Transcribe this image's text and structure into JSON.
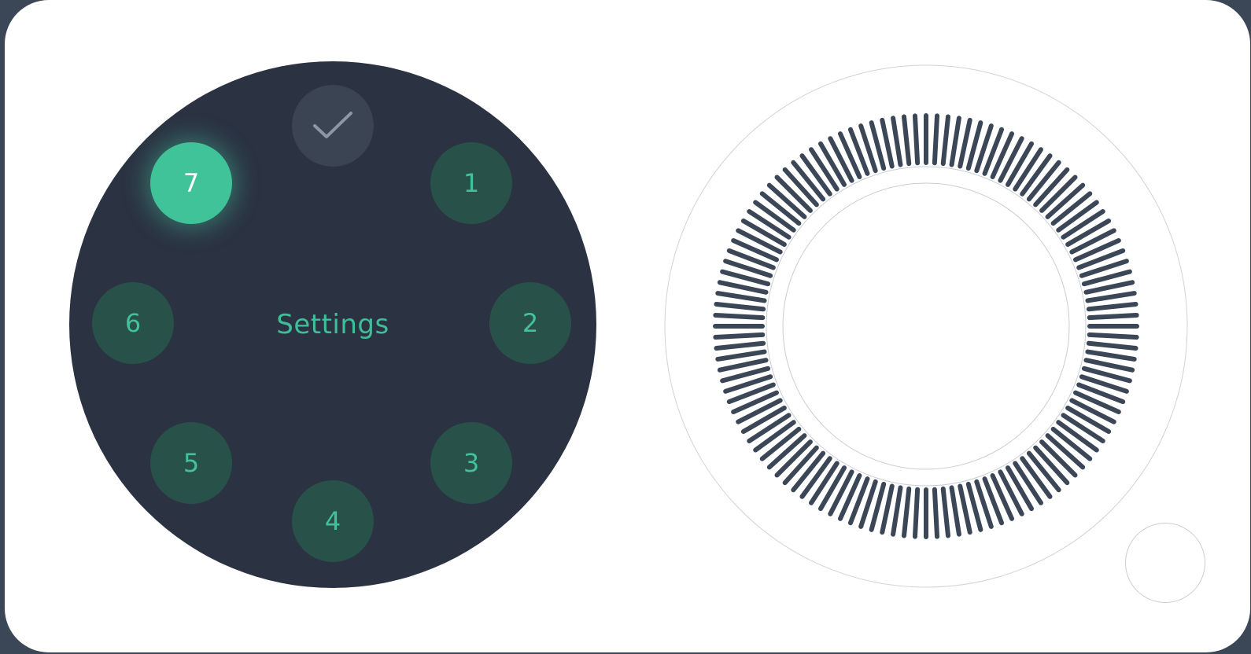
{
  "menu": {
    "title": "Settings",
    "confirm_icon": "check-icon",
    "options": [
      {
        "label": "1",
        "selected": false
      },
      {
        "label": "2",
        "selected": false
      },
      {
        "label": "3",
        "selected": false
      },
      {
        "label": "4",
        "selected": false
      },
      {
        "label": "5",
        "selected": false
      },
      {
        "label": "6",
        "selected": false
      },
      {
        "label": "7",
        "selected": true
      }
    ]
  },
  "wheel": {
    "tick_count": 120,
    "tick_color": "#3b4656"
  },
  "colors": {
    "background": "#3b4656",
    "card": "#ffffff",
    "dial": "#2b3242",
    "accent": "#40c398",
    "option_idle": "#285249"
  }
}
